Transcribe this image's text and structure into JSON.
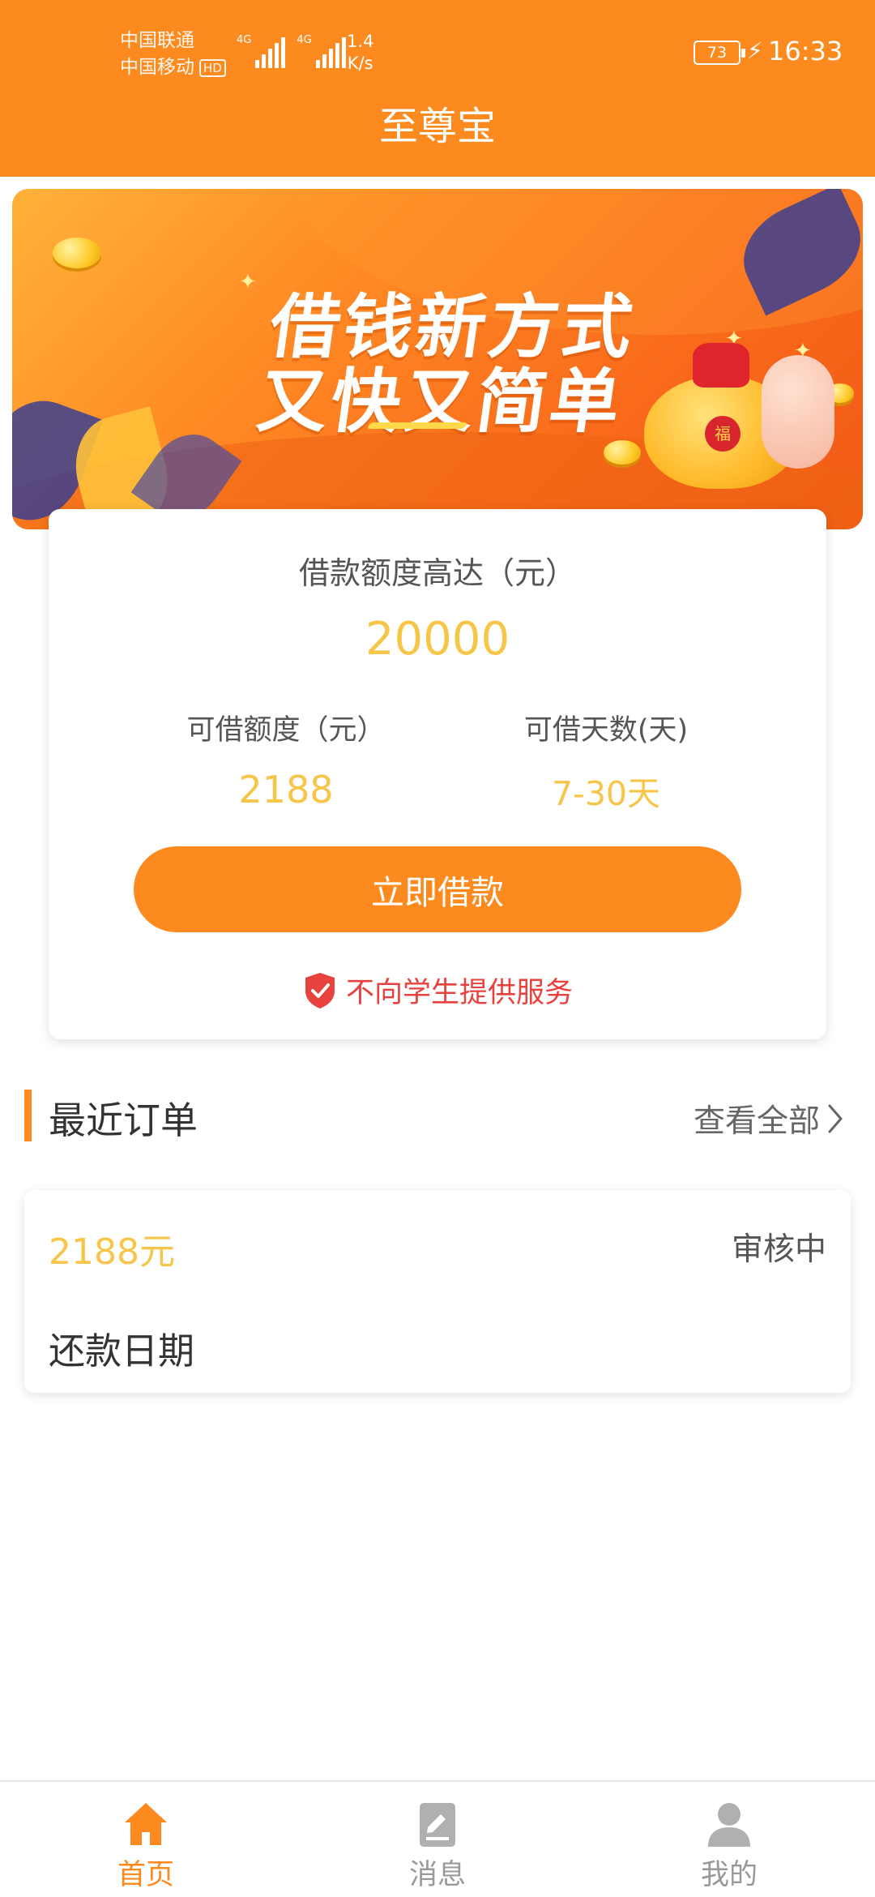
{
  "status_bar": {
    "carrier_1": "中国联通",
    "carrier_2": "中国移动",
    "hd_badge": "HD",
    "signal_1_tag": "4G",
    "signal_2_tag": "4G",
    "net_speed_value": "1.4",
    "net_speed_unit": "K/s",
    "battery": "73",
    "time": "16:33"
  },
  "header": {
    "title": "至尊宝"
  },
  "banner": {
    "line_1": "借钱新方式",
    "line_2": "又快又简单",
    "bag_tag": "福"
  },
  "loan_card": {
    "limit_label": "借款额度高达（元）",
    "limit_value": "20000",
    "available_label": "可借额度（元）",
    "available_value": "2188",
    "days_label": "可借天数(天)",
    "days_value": "7-30天",
    "borrow_button": "立即借款",
    "notice": "不向学生提供服务"
  },
  "recent_orders": {
    "title": "最近订单",
    "view_all": "查看全部",
    "orders": [
      {
        "amount": "2188元",
        "status": "审核中",
        "repay_date_label": "还款日期"
      }
    ]
  },
  "tab_bar": {
    "tabs": [
      {
        "label": "首页",
        "icon": "home-icon",
        "active": true
      },
      {
        "label": "消息",
        "icon": "message-icon",
        "active": false
      },
      {
        "label": "我的",
        "icon": "profile-icon",
        "active": false
      }
    ]
  },
  "colors": {
    "primary": "#fd8a1e",
    "amount_yellow": "#f7c548",
    "warning_red": "#e8413e"
  }
}
